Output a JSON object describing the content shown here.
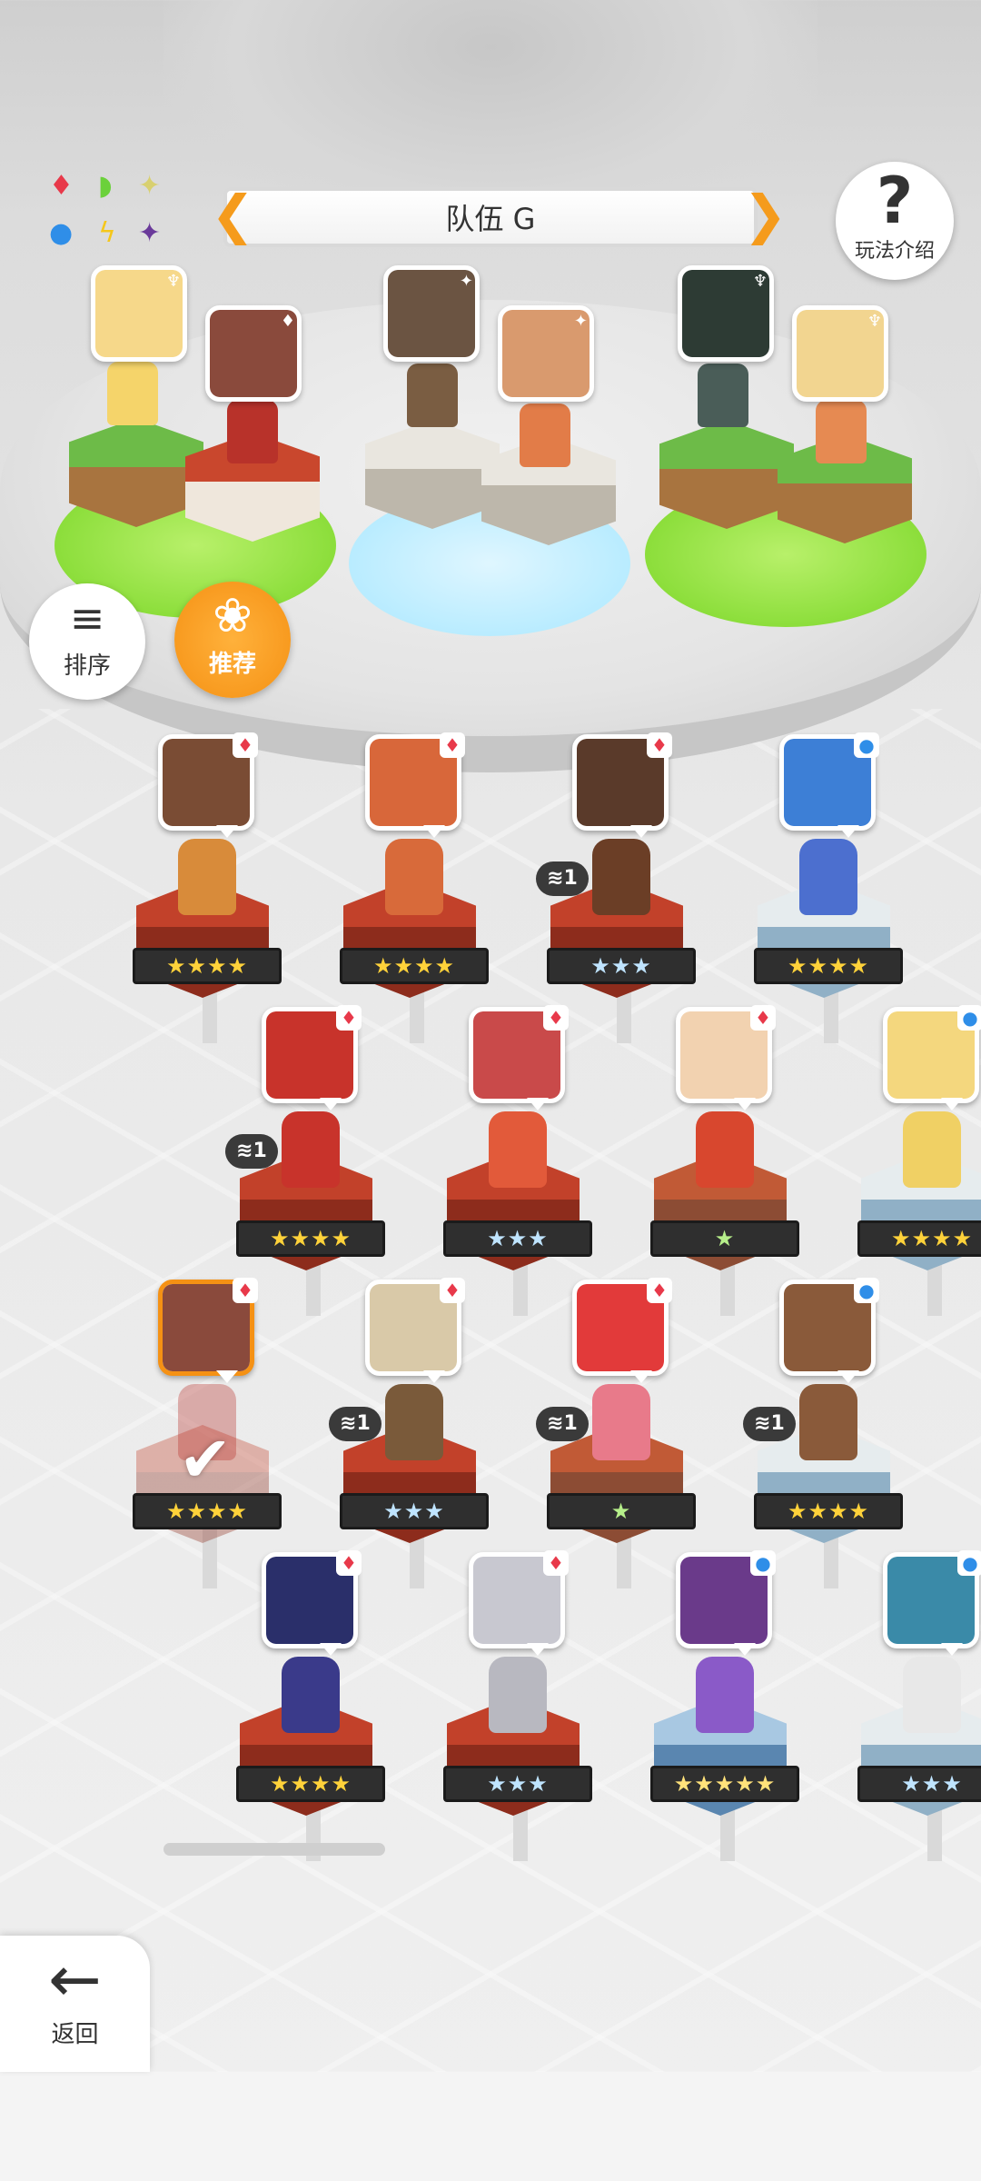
{
  "header": {
    "team_title": "队伍 G",
    "help_label": "玩法介绍",
    "help_icon": "?"
  },
  "element_chart": {
    "symbols": [
      "♦",
      "◗",
      "✦",
      "●",
      "ϟ",
      "✦"
    ],
    "colors": {
      "fire": "#e8394a",
      "wind": "#6bd13b",
      "light": "#e6e98a",
      "water": "#2f8ee8",
      "thunder": "#f5c71b",
      "dark": "#6a3a9a"
    }
  },
  "side_buttons": {
    "sort_label": "排序",
    "sort_icon": "sort-icon",
    "recommend_label": "推荐",
    "recommend_icon": "flower-icon"
  },
  "team": [
    {
      "face": "#f6d88a",
      "sprite": "#f5d46a",
      "block": "grass",
      "badge": "♆"
    },
    {
      "face": "#8a4a3c",
      "sprite": "#b8322a",
      "block": "red",
      "badge": "♦"
    },
    {
      "face": "#6b5442",
      "sprite": "#7a5d42",
      "block": "stone",
      "badge": "✦"
    },
    {
      "face": "#d99a6e",
      "sprite": "#e27c48",
      "block": "stone",
      "badge": "✦"
    },
    {
      "face": "#2d3b34",
      "sprite": "#4a5d58",
      "block": "grass",
      "badge": "♆"
    },
    {
      "face": "#f2d590",
      "sprite": "#e68a52",
      "block": "grass",
      "badge": "♆"
    }
  ],
  "roster": [
    {
      "face": "#7a4c34",
      "sprite": "#d88b3a",
      "hex": "red",
      "badge": "♦",
      "badge_type": "fire",
      "stars": "★★★★",
      "tier": "gold",
      "dup": ""
    },
    {
      "face": "#d8673a",
      "sprite": "#d86a3a",
      "hex": "red",
      "badge": "♦",
      "badge_type": "fire",
      "stars": "★★★★",
      "tier": "gold",
      "dup": ""
    },
    {
      "face": "#5a3a2a",
      "sprite": "#6b3e26",
      "hex": "red",
      "badge": "♦",
      "badge_type": "fire",
      "stars": "★★★",
      "tier": "silver",
      "dup": "1"
    },
    {
      "face": "#3d7fd6",
      "sprite": "#4c6fcf",
      "hex": "ice",
      "badge": "●",
      "badge_type": "water",
      "stars": "★★★★",
      "tier": "gold",
      "dup": ""
    },
    {
      "face": "#c8332b",
      "sprite": "#c8332b",
      "hex": "red",
      "badge": "♦",
      "badge_type": "fire",
      "stars": "★★★★",
      "tier": "gold",
      "dup": "1"
    },
    {
      "face": "#c94a4a",
      "sprite": "#e25a3a",
      "hex": "red",
      "badge": "♦",
      "badge_type": "fire",
      "stars": "★★★",
      "tier": "silver",
      "dup": ""
    },
    {
      "face": "#f2d2b0",
      "sprite": "#d8472e",
      "hex": "rock",
      "badge": "♦",
      "badge_type": "fire",
      "stars": "★",
      "tier": "green",
      "dup": ""
    },
    {
      "face": "#f4d77e",
      "sprite": "#f0d064",
      "hex": "ice",
      "badge": "●",
      "badge_type": "water",
      "stars": "★★★★",
      "tier": "gold",
      "dup": ""
    },
    {
      "face": "#8a4a3c",
      "sprite": "#b8322a",
      "hex": "red",
      "badge": "♦",
      "badge_type": "fire",
      "stars": "★★★★",
      "tier": "gold",
      "dup": "",
      "selected": true,
      "check": "✔"
    },
    {
      "face": "#d9c9a8",
      "sprite": "#7a5a3a",
      "hex": "red",
      "badge": "♦",
      "badge_type": "fire",
      "stars": "★★★",
      "tier": "silver",
      "dup": "1"
    },
    {
      "face": "#e23a3a",
      "sprite": "#e87a8a",
      "hex": "rock",
      "badge": "♦",
      "badge_type": "fire",
      "stars": "★",
      "tier": "green",
      "dup": "1"
    },
    {
      "face": "#8a5a3a",
      "sprite": "#8a5a3a",
      "hex": "ice",
      "badge": "●",
      "badge_type": "water",
      "stars": "★★★★",
      "tier": "gold",
      "dup": "1"
    },
    {
      "face": "#2a2f6a",
      "sprite": "#3a3a8a",
      "hex": "red",
      "badge": "♦",
      "badge_type": "fire",
      "stars": "★★★★",
      "tier": "gold",
      "dup": ""
    },
    {
      "face": "#c8c8d0",
      "sprite": "#b8b8c0",
      "hex": "red",
      "badge": "♦",
      "badge_type": "fire",
      "stars": "★★★",
      "tier": "silver",
      "dup": ""
    },
    {
      "face": "#6a3a8a",
      "sprite": "#8a5ac8",
      "hex": "blue",
      "badge": "●",
      "badge_type": "water",
      "stars": "★★★★★",
      "tier": "rainbow",
      "dup": ""
    },
    {
      "face": "#3a8aa8",
      "sprite": "#e8e8e8",
      "hex": "ice",
      "badge": "●",
      "badge_type": "water",
      "stars": "★★★",
      "tier": "silver",
      "dup": ""
    }
  ],
  "footer": {
    "back_label": "返回",
    "back_icon": "←"
  }
}
